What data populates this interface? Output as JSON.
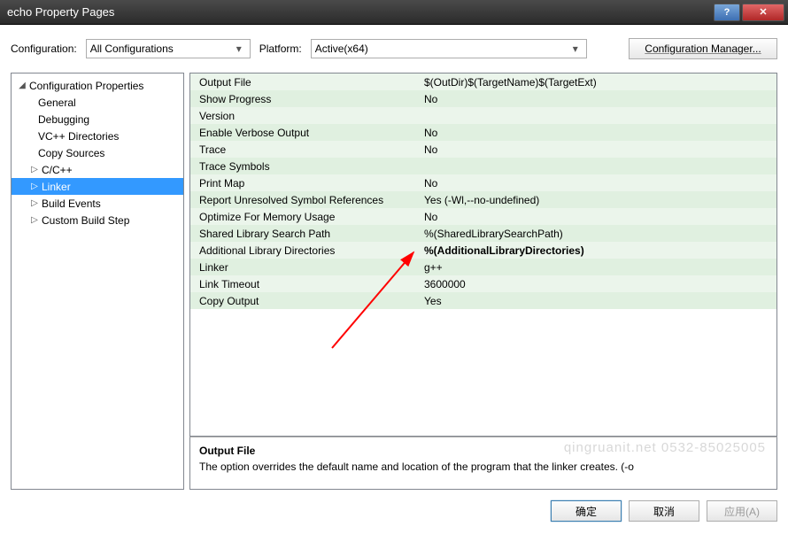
{
  "window": {
    "title": "echo Property Pages"
  },
  "toolbar": {
    "config_label": "Configuration:",
    "config_value": "All Configurations",
    "platform_label": "Platform:",
    "platform_value": "Active(x64)",
    "cfg_mgr_label": "Configuration Manager..."
  },
  "tree": {
    "root": "Configuration Properties",
    "items": [
      {
        "label": "General",
        "indent": "leaf"
      },
      {
        "label": "Debugging",
        "indent": "leaf"
      },
      {
        "label": "VC++ Directories",
        "indent": "leaf"
      },
      {
        "label": "Copy Sources",
        "indent": "leaf"
      },
      {
        "label": "C/C++",
        "indent": "branch"
      },
      {
        "label": "Linker",
        "indent": "branch",
        "selected": true
      },
      {
        "label": "Build Events",
        "indent": "branch"
      },
      {
        "label": "Custom Build Step",
        "indent": "branch"
      }
    ]
  },
  "grid": {
    "rows": [
      {
        "k": "Output File",
        "v": "$(OutDir)$(TargetName)$(TargetExt)"
      },
      {
        "k": "Show Progress",
        "v": "No"
      },
      {
        "k": "Version",
        "v": ""
      },
      {
        "k": "Enable Verbose Output",
        "v": "No"
      },
      {
        "k": "Trace",
        "v": "No"
      },
      {
        "k": "Trace Symbols",
        "v": ""
      },
      {
        "k": "Print Map",
        "v": "No"
      },
      {
        "k": "Report Unresolved Symbol References",
        "v": "Yes (-Wl,--no-undefined)"
      },
      {
        "k": "Optimize For Memory Usage",
        "v": "No"
      },
      {
        "k": "Shared Library Search Path",
        "v": "%(SharedLibrarySearchPath)"
      },
      {
        "k": "Additional Library Directories",
        "v": "%(AdditionalLibraryDirectories)",
        "bold": true
      },
      {
        "k": "Linker",
        "v": "g++"
      },
      {
        "k": "Link Timeout",
        "v": "3600000"
      },
      {
        "k": "Copy Output",
        "v": "Yes"
      }
    ]
  },
  "desc": {
    "heading": "Output File",
    "body": "The option overrides the default name and location of the program that the linker creates. (-o"
  },
  "watermark": "qingruanit.net 0532-85025005",
  "buttons": {
    "ok": "确定",
    "cancel": "取消",
    "apply": "应用(A)"
  }
}
